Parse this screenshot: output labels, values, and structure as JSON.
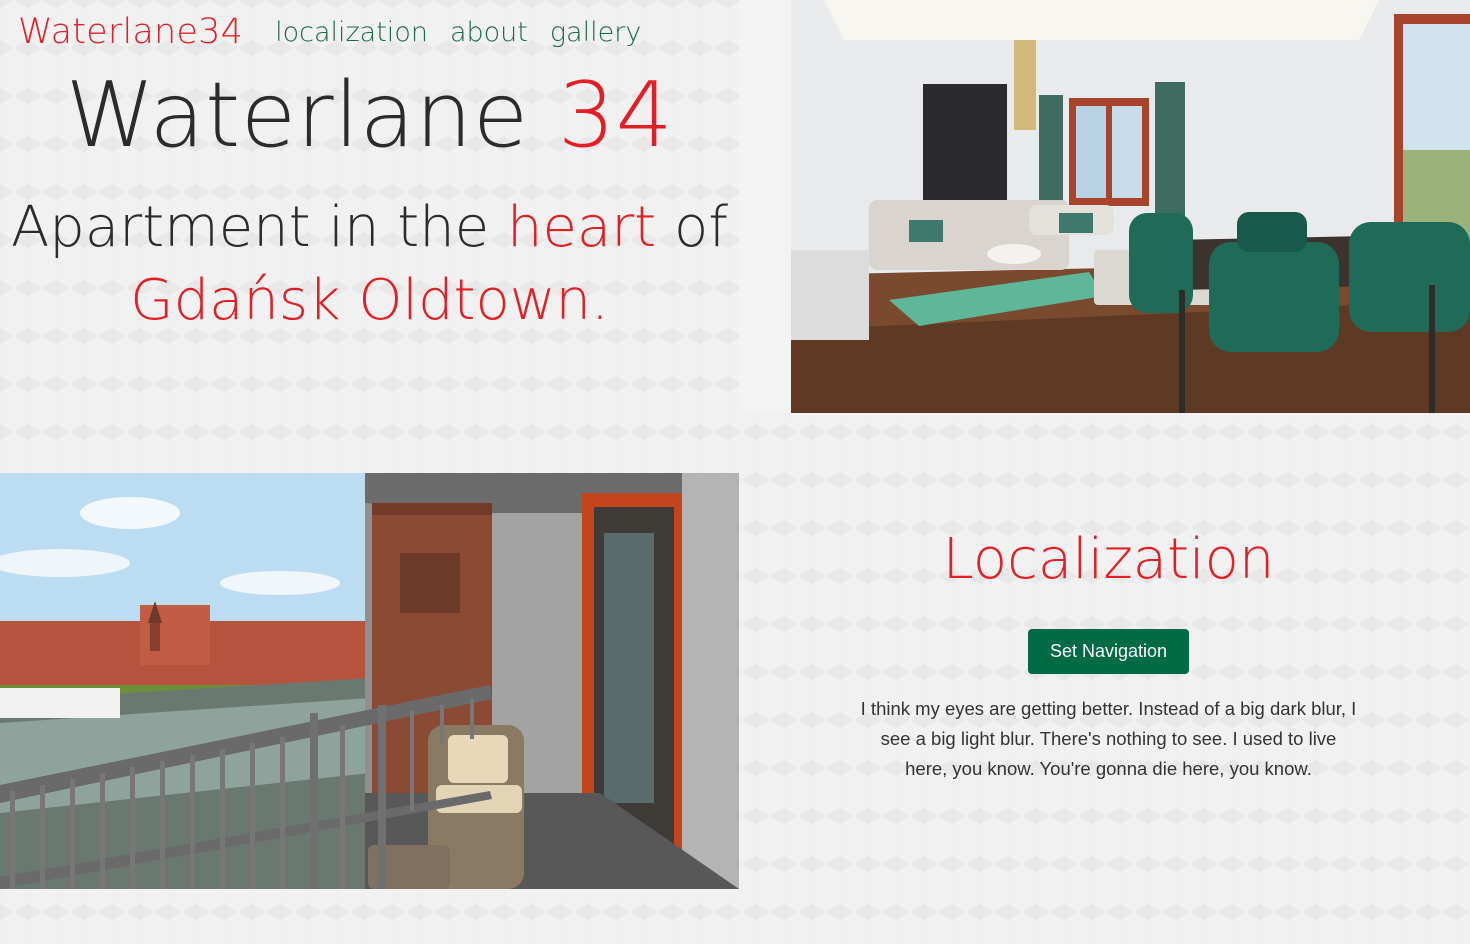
{
  "colors": {
    "accent_red": "#e31e24",
    "nav_green": "#1a6b48",
    "button_green": "#006b45",
    "text_dark": "#2b2b2b"
  },
  "header": {
    "brand": "Waterlane34",
    "nav": [
      {
        "label": "localization"
      },
      {
        "label": "about"
      },
      {
        "label": "gallery"
      }
    ]
  },
  "hero": {
    "title_main": "Waterlane ",
    "title_number": "34",
    "subtitle_1": "Apartment in the ",
    "subtitle_highlight": "heart",
    "subtitle_2": " of",
    "subtitle_place": "Gdańsk Oldtown."
  },
  "images": {
    "living_room": "living-room-photo",
    "balcony": "balcony-river-view-photo"
  },
  "localization": {
    "heading": "Localization",
    "button_label": "Set Navigation",
    "text": "I think my eyes are getting better. Instead of a big dark blur, I see a big light blur. There's nothing to see. I used to live here, you know. You're gonna die here, you know."
  }
}
